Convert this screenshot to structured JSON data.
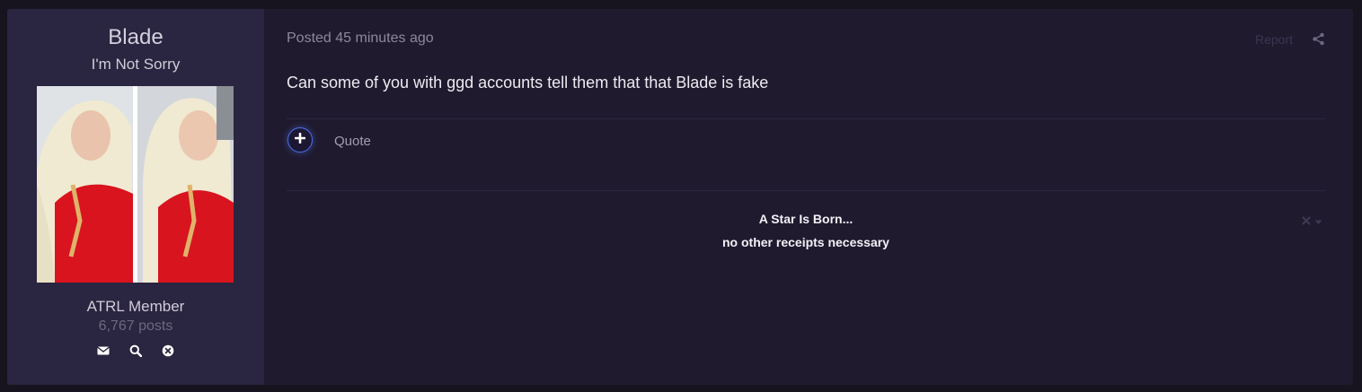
{
  "author": {
    "name": "Blade",
    "title": "I'm Not Sorry",
    "group": "ATRL Member",
    "post_count": "6,767 posts",
    "actions": [
      "envelope-icon",
      "search-icon",
      "block-icon"
    ]
  },
  "post": {
    "meta": "Posted 45 minutes ago",
    "report_label": "Report",
    "content": "Can some of you with ggd accounts tell them that that Blade is fake",
    "quote_label": "Quote",
    "signature": {
      "line1": "A Star Is Born...",
      "line2": "no other receipts necessary"
    }
  },
  "colors": {
    "background": "#17141f",
    "post_bg": "#201a2f",
    "author_bg": "#2a2540",
    "accent": "#4a6fe6"
  }
}
